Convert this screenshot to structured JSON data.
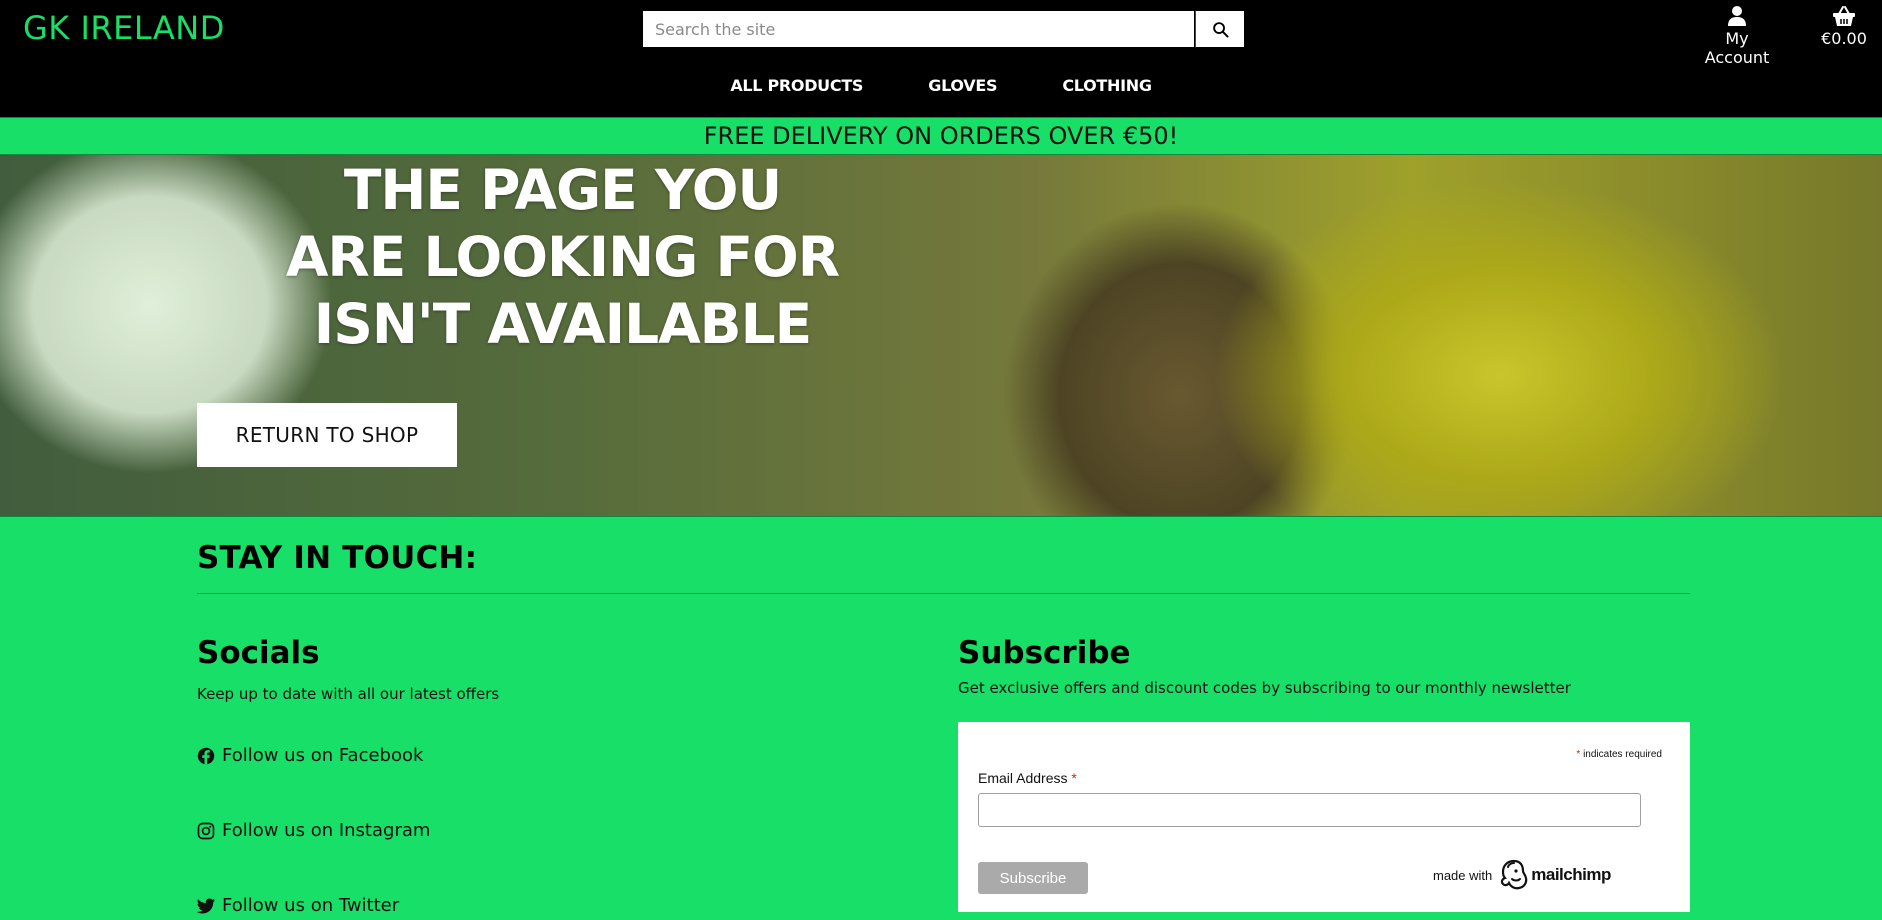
{
  "header": {
    "brand": "GK IRELAND",
    "search_placeholder": "Search the site",
    "account_label": "My Account",
    "cart_total": "€0.00"
  },
  "nav": {
    "items": [
      {
        "label": "ALL PRODUCTS"
      },
      {
        "label": "GLOVES"
      },
      {
        "label": "CLOTHING"
      }
    ]
  },
  "promo": {
    "text": "FREE DELIVERY ON ORDERS OVER €50!"
  },
  "hero": {
    "title": "THE PAGE YOU ARE LOOKING FOR ISN'T AVAILABLE",
    "button_label": "RETURN TO SHOP"
  },
  "footer": {
    "title": "STAY IN TOUCH:",
    "socials": {
      "title": "Socials",
      "description": "Keep up to date with all our latest offers",
      "links": [
        {
          "label": "Follow us on Facebook",
          "icon": "facebook-icon"
        },
        {
          "label": "Follow us on Instagram",
          "icon": "instagram-icon"
        },
        {
          "label": "Follow us on Twitter",
          "icon": "twitter-icon"
        }
      ]
    },
    "subscribe": {
      "title": "Subscribe",
      "description": "Get exclusive offers and discount codes by subscribing to our monthly newsletter",
      "required_note": "indicates required",
      "email_label": "Email Address",
      "email_value": "",
      "button_label": "Subscribe",
      "made_with": "made with",
      "provider": "mailchimp"
    }
  },
  "colors": {
    "brand_green": "#17df68",
    "header_bg": "#000000",
    "required_star": "#c02b0a"
  }
}
